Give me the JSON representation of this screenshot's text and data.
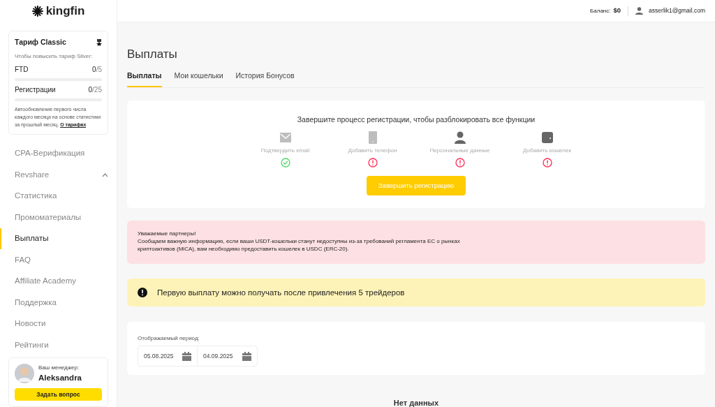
{
  "logo": {
    "text": "kingfin"
  },
  "tariff": {
    "title": "Тариф Classic",
    "subtitle": "Чтобы повысить тариф Silver:",
    "metrics": [
      {
        "label": "FTD",
        "current": "0",
        "total": "/5",
        "level": 0
      },
      {
        "label": "Регистрации",
        "current": "0",
        "total": "/25",
        "level": 0
      }
    ],
    "note": "Автообновление первого числа каждого месяца на основе статистики за прошлый месяц.",
    "link": "О тарифах"
  },
  "nav": [
    {
      "label": "CPA-Верификация",
      "selected": false
    },
    {
      "label": "Revshare",
      "selected": false,
      "expanded": true
    },
    {
      "label": "Статистика",
      "selected": false
    },
    {
      "label": "Промоматериалы",
      "selected": false
    },
    {
      "label": "Выплаты",
      "selected": true
    },
    {
      "label": "FAQ",
      "selected": false
    },
    {
      "label": "Affiliate Academy",
      "selected": false
    },
    {
      "label": "Поддержка",
      "selected": false
    },
    {
      "label": "Новости",
      "selected": false
    },
    {
      "label": "Рейтинги",
      "selected": false
    }
  ],
  "manager": {
    "caption": "Ваш менеджер:",
    "name": "Aleksandra",
    "button": "Задать вопрос"
  },
  "header": {
    "balance_label": "Баланс:",
    "balance": "$0",
    "email": "asserlik1@gmail.com"
  },
  "page_title": "Выплаты",
  "tabs": [
    {
      "label": "Выплаты",
      "selected": true
    },
    {
      "label": "Мои кошельки",
      "selected": false
    },
    {
      "label": "История Бонусов",
      "selected": false
    }
  ],
  "registration": {
    "title": "Завершите процесс регистрации, чтобы разблокировать все функции",
    "steps": [
      {
        "kind": "email",
        "label": "Подтвердить email",
        "completed": true
      },
      {
        "kind": "phone",
        "label": "Добавить телефон",
        "completed": false
      },
      {
        "kind": "person",
        "label": "Персональные данные",
        "completed": false
      },
      {
        "kind": "wallet",
        "label": "Добавить кошелек",
        "completed": false
      }
    ],
    "button": "Завершить регистрацию"
  },
  "notice": {
    "heading": "Уважаемые партнеры!",
    "text": "Сообщаем важную информацию, если ваши USDT-кошельки станут недоступны из-за требований регламента ЕС о рынках криптоактивов (MiCA), вам необходимо предоставить кошелек в USDC (ERC-20)."
  },
  "warning": {
    "text": "Первую выплату можно получать после привлечения 5 трейдеров"
  },
  "period": {
    "label": "Отображаемый период:",
    "from": "05.08.2025",
    "to": "04.09.2025"
  },
  "empty": "Нет данных"
}
